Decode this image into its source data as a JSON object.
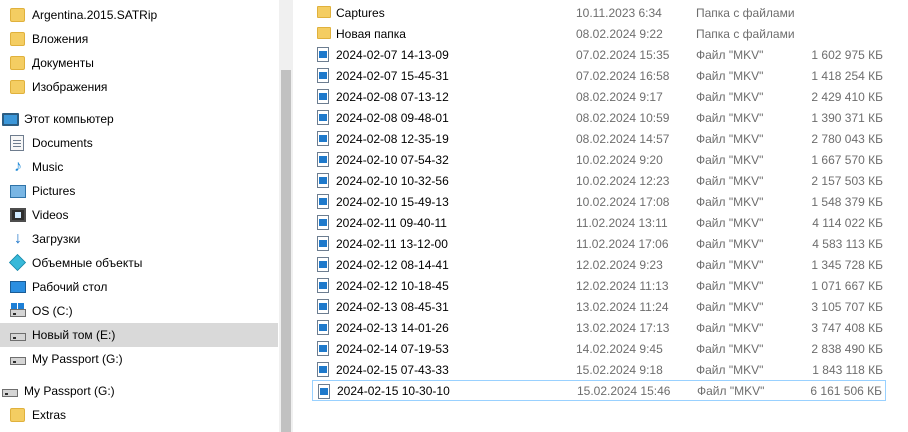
{
  "nav": {
    "items": [
      {
        "label": "Argentina.2015.SATRip",
        "icon": "folder-icon"
      },
      {
        "label": "Вложения",
        "icon": "folder-icon"
      },
      {
        "label": "Документы",
        "icon": "folder-icon"
      },
      {
        "label": "Изображения",
        "icon": "folder-icon"
      },
      {
        "label": "Этот компьютер",
        "icon": "computer-icon"
      },
      {
        "label": "Documents",
        "icon": "documents-icon"
      },
      {
        "label": "Music",
        "icon": "music-icon"
      },
      {
        "label": "Pictures",
        "icon": "pictures-icon"
      },
      {
        "label": "Videos",
        "icon": "videos-icon"
      },
      {
        "label": "Загрузки",
        "icon": "downloads-icon"
      },
      {
        "label": "Объемные объекты",
        "icon": "3d-objects-icon"
      },
      {
        "label": "Рабочий стол",
        "icon": "desktop-icon"
      },
      {
        "label": "OS (C:)",
        "icon": "os-drive-icon"
      },
      {
        "label": "Новый том (E:)",
        "icon": "drive-icon"
      },
      {
        "label": "My Passport (G:)",
        "icon": "drive-icon"
      },
      {
        "label": "My Passport (G:)",
        "icon": "drive-icon"
      },
      {
        "label": "Extras",
        "icon": "folder-icon"
      }
    ]
  },
  "files": [
    {
      "name": "Captures",
      "date": "10.11.2023 6:34",
      "type": "Папка с файлами",
      "size": "",
      "kind": "folder"
    },
    {
      "name": "Новая папка",
      "date": "08.02.2024 9:22",
      "type": "Папка с файлами",
      "size": "",
      "kind": "folder"
    },
    {
      "name": "2024-02-07 14-13-09",
      "date": "07.02.2024 15:35",
      "type": "Файл \"MKV\"",
      "size": "1 602 975 КБ",
      "kind": "mkv"
    },
    {
      "name": "2024-02-07 15-45-31",
      "date": "07.02.2024 16:58",
      "type": "Файл \"MKV\"",
      "size": "1 418 254 КБ",
      "kind": "mkv"
    },
    {
      "name": "2024-02-08 07-13-12",
      "date": "08.02.2024 9:17",
      "type": "Файл \"MKV\"",
      "size": "2 429 410 КБ",
      "kind": "mkv"
    },
    {
      "name": "2024-02-08 09-48-01",
      "date": "08.02.2024 10:59",
      "type": "Файл \"MKV\"",
      "size": "1 390 371 КБ",
      "kind": "mkv"
    },
    {
      "name": "2024-02-08 12-35-19",
      "date": "08.02.2024 14:57",
      "type": "Файл \"MKV\"",
      "size": "2 780 043 КБ",
      "kind": "mkv"
    },
    {
      "name": "2024-02-10 07-54-32",
      "date": "10.02.2024 9:20",
      "type": "Файл \"MKV\"",
      "size": "1 667 570 КБ",
      "kind": "mkv"
    },
    {
      "name": "2024-02-10 10-32-56",
      "date": "10.02.2024 12:23",
      "type": "Файл \"MKV\"",
      "size": "2 157 503 КБ",
      "kind": "mkv"
    },
    {
      "name": "2024-02-10 15-49-13",
      "date": "10.02.2024 17:08",
      "type": "Файл \"MKV\"",
      "size": "1 548 379 КБ",
      "kind": "mkv"
    },
    {
      "name": "2024-02-11 09-40-11",
      "date": "11.02.2024 13:11",
      "type": "Файл \"MKV\"",
      "size": "4 114 022 КБ",
      "kind": "mkv"
    },
    {
      "name": "2024-02-11 13-12-00",
      "date": "11.02.2024 17:06",
      "type": "Файл \"MKV\"",
      "size": "4 583 113 КБ",
      "kind": "mkv"
    },
    {
      "name": "2024-02-12 08-14-41",
      "date": "12.02.2024 9:23",
      "type": "Файл \"MKV\"",
      "size": "1 345 728 КБ",
      "kind": "mkv"
    },
    {
      "name": "2024-02-12 10-18-45",
      "date": "12.02.2024 11:13",
      "type": "Файл \"MKV\"",
      "size": "1 071 667 КБ",
      "kind": "mkv"
    },
    {
      "name": "2024-02-13 08-45-31",
      "date": "13.02.2024 11:24",
      "type": "Файл \"MKV\"",
      "size": "3 105 707 КБ",
      "kind": "mkv"
    },
    {
      "name": "2024-02-13 14-01-26",
      "date": "13.02.2024 17:13",
      "type": "Файл \"MKV\"",
      "size": "3 747 408 КБ",
      "kind": "mkv"
    },
    {
      "name": "2024-02-14 07-19-53",
      "date": "14.02.2024 9:45",
      "type": "Файл \"MKV\"",
      "size": "2 838 490 КБ",
      "kind": "mkv"
    },
    {
      "name": "2024-02-15 07-43-33",
      "date": "15.02.2024 9:18",
      "type": "Файл \"MKV\"",
      "size": "1 843 118 КБ",
      "kind": "mkv"
    },
    {
      "name": "2024-02-15 10-30-10",
      "date": "15.02.2024 15:46",
      "type": "Файл \"MKV\"",
      "size": "6 161 506 КБ",
      "kind": "mkv"
    }
  ]
}
